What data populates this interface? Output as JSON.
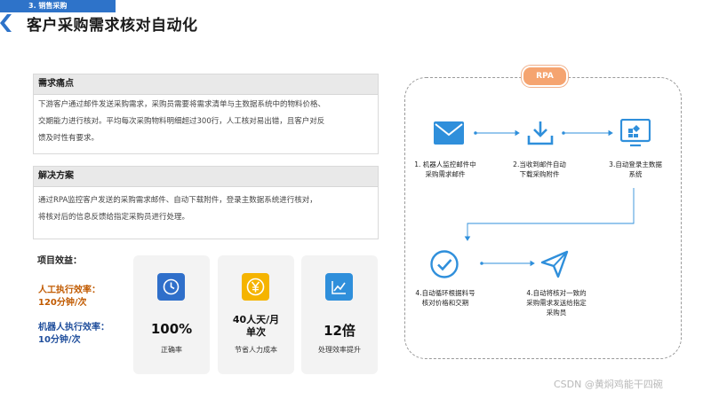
{
  "header": {
    "section_tag": "3. 销售采购",
    "title": "客户采购需求核对自动化"
  },
  "pain": {
    "heading": "需求痛点",
    "lines": [
      "下游客户通过邮件发送采购需求，采购员需要将需求清单与主数据系统中的物料价格、",
      "交期能力进行核对。平均每次采购物料明细超过300行，人工核对易出错，且客户对反",
      "馈及时性有要求。"
    ]
  },
  "solution": {
    "heading": "解决方案",
    "lines": [
      "通过RPA监控客户发送的采购需求邮件、自动下载附件，登录主数据系统进行核对，",
      "将核对后的信息反馈给指定采购员进行处理。"
    ]
  },
  "benefits": {
    "label": "项目效益：",
    "manual_label": "人工执行效率：",
    "manual_value": "120分钟/次",
    "robot_label": "机器人执行效率：",
    "robot_value": "10分钟/次",
    "cards": [
      {
        "value": "100%",
        "caption": "正确率",
        "icon": "clock-icon",
        "color": "#2f6fca"
      },
      {
        "value_line1": "40人天/月",
        "value_line2": "单次",
        "caption": "节省人力成本",
        "icon": "yen-icon",
        "color": "#f5b400"
      },
      {
        "value": "12倍",
        "caption": "处理效率提升",
        "icon": "chart-icon",
        "color": "#2f8fdb"
      }
    ]
  },
  "flow": {
    "badge": "RPA",
    "steps": [
      {
        "lines": [
          "1. 机器人监控邮件中",
          "采购需求邮件"
        ],
        "icon": "mail-icon"
      },
      {
        "lines": [
          "2.当收到邮件自动",
          "下载采购附件"
        ],
        "icon": "download-icon"
      },
      {
        "lines": [
          "3.自动登录主数据",
          "系统"
        ],
        "icon": "system-icon"
      },
      {
        "lines": [
          "4.自动循环根据料号",
          "核对价格和交期"
        ],
        "icon": "check-circle-icon"
      },
      {
        "lines": [
          "4.自动将核对一致的",
          "采购需求发送给指定",
          "采购员"
        ],
        "icon": "send-icon"
      }
    ],
    "color": "#2f8fdb"
  },
  "footer": {
    "watermark": "CSDN @黄焖鸡能干四碗"
  }
}
